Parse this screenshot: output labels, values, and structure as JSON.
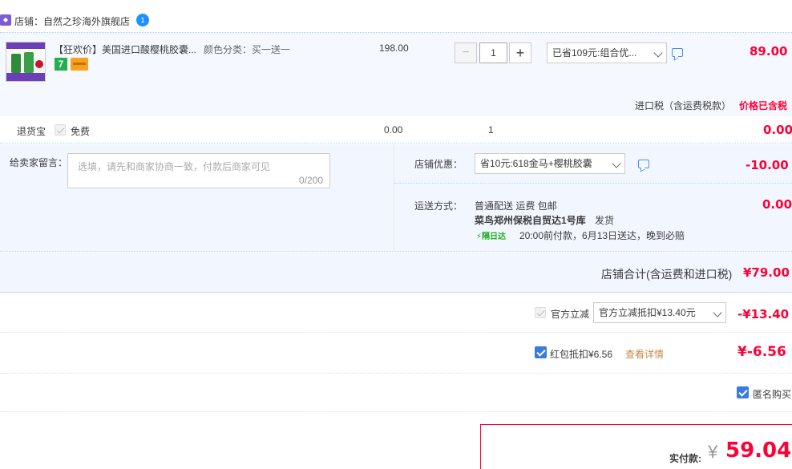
{
  "shop": {
    "label": "店铺：自然之珍海外旗舰店",
    "icon": "shop-icon",
    "ww_badge": "1"
  },
  "item": {
    "title": "【狂欢价】美国进口酸樱桃胶囊...",
    "sku": "颜色分类：买一送一",
    "unit_price": "198.00",
    "quantity": "1",
    "qty_minus": "−",
    "qty_plus": "+",
    "promo_selected": "已省109元:组合优...",
    "total": "89.00",
    "badges": [
      "7",
      "card-icon"
    ],
    "tax_label": "进口税（含运费税款）",
    "tax_value": "价格已含税"
  },
  "return_insurance": {
    "label": "退货宝",
    "option": "免费",
    "price": "0.00",
    "qty": "1",
    "total": "0.00"
  },
  "message": {
    "label": "给卖家留言：",
    "placeholder": "选填，请先和商家协商一致，付款后商家可见",
    "counter": "0/200"
  },
  "shop_promo": {
    "label": "店铺优惠：",
    "selected": "省10元:618金马+樱桃胶囊",
    "value": "-10.00"
  },
  "shipping": {
    "label": "运送方式：",
    "method": "普通配送 运费 包邮",
    "warehouse": "菜鸟郑州保税自贸达1号库",
    "warehouse_tail": "发货",
    "badge": "隔日达",
    "note": "20:00前付款，6月13日送达，晚到必赔",
    "value": "0.00"
  },
  "shop_total": {
    "label": "店铺合计(含运费和进口税)",
    "value": "¥79.00"
  },
  "official_discount": {
    "label": "官方立减",
    "selected": "官方立减抵扣¥13.40元",
    "value": "-¥13.40"
  },
  "red_packet": {
    "label": "红包抵扣¥6.56",
    "link": "查看详情",
    "value": "¥-6.56"
  },
  "anonymous": {
    "label": "匿名购买"
  },
  "payment": {
    "label": "实付款:",
    "currency": "¥",
    "amount": "59.04"
  },
  "colors": {
    "accent_red": "#ff0036",
    "check_blue": "#3a7be0",
    "row_bg": "#f5f8ff"
  }
}
